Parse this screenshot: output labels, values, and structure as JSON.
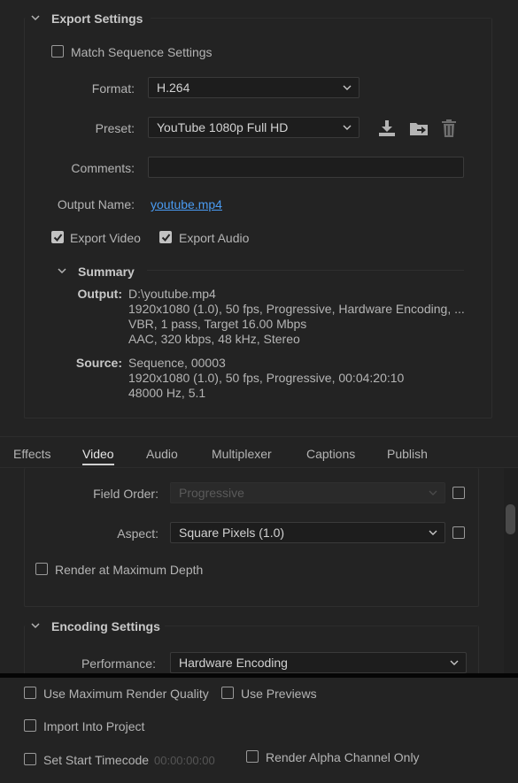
{
  "export_settings": {
    "header": "Export Settings",
    "match_sequence": "Match Sequence Settings",
    "format_label": "Format:",
    "format_value": "H.264",
    "preset_label": "Preset:",
    "preset_value": "YouTube 1080p Full HD",
    "comments_label": "Comments:",
    "comments_value": "",
    "output_name_label": "Output Name:",
    "output_name_value": "youtube.mp4",
    "export_video": "Export Video",
    "export_audio": "Export Audio",
    "icons": [
      "save-preset-icon",
      "import-preset-icon",
      "delete-preset-icon"
    ]
  },
  "summary": {
    "header": "Summary",
    "output_label": "Output:",
    "output_lines": [
      "D:\\youtube.mp4",
      "1920x1080 (1.0), 50 fps, Progressive, Hardware Encoding, ...",
      "VBR, 1 pass, Target 16.00 Mbps",
      "AAC, 320 kbps, 48 kHz, Stereo"
    ],
    "source_label": "Source:",
    "source_lines": [
      "Sequence, 00003",
      "1920x1080 (1.0), 50 fps, Progressive, 00:04:20:10",
      "48000 Hz, 5.1"
    ]
  },
  "tabs": [
    "Effects",
    "Video",
    "Audio",
    "Multiplexer",
    "Captions",
    "Publish"
  ],
  "active_tab": "Video",
  "video": {
    "field_order_label": "Field Order:",
    "field_order_value": "Progressive",
    "aspect_label": "Aspect:",
    "aspect_value": "Square Pixels (1.0)",
    "render_max_depth": "Render at Maximum Depth"
  },
  "encoding": {
    "header": "Encoding Settings",
    "performance_label": "Performance:",
    "performance_value": "Hardware Encoding"
  },
  "bottom": {
    "use_max_render_quality": "Use Maximum Render Quality",
    "use_previews": "Use Previews",
    "import_into_project": "Import Into Project",
    "set_start_timecode": "Set Start Timecode",
    "timecode_value": "00:00:00:00",
    "render_alpha_only": "Render Alpha Channel Only"
  },
  "colors": {
    "background": "#232323",
    "link": "#4a9bf2",
    "text": "#b4b4b4"
  }
}
